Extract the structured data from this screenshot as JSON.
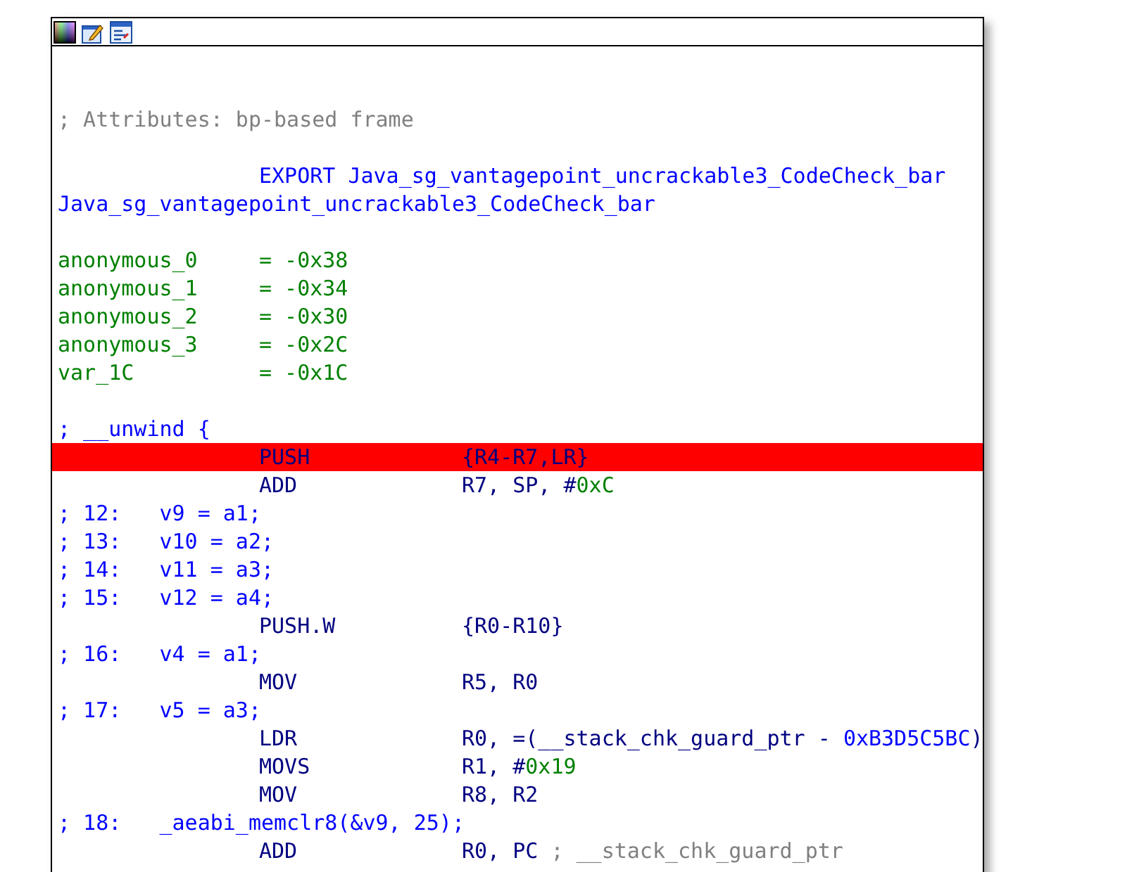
{
  "toolbar": {
    "buttons": [
      {
        "kind": "palette"
      },
      {
        "kind": "edit"
      },
      {
        "kind": "graph"
      }
    ]
  },
  "listing": [
    {
      "kind": "blank",
      "selected": false
    },
    {
      "kind": "blank",
      "selected": false
    },
    {
      "kind": "comment",
      "text": "; Attributes: bp-based frame",
      "selected": false
    },
    {
      "kind": "blank",
      "selected": false
    },
    {
      "kind": "export",
      "text": "EXPORT Java_sg_vantagepoint_uncrackable3_CodeCheck_bar",
      "selected": false
    },
    {
      "kind": "label",
      "text": "Java_sg_vantagepoint_uncrackable3_CodeCheck_bar",
      "selected": false
    },
    {
      "kind": "blank",
      "selected": false
    },
    {
      "kind": "stackvar",
      "name": "anonymous_0",
      "value": "= -0x38",
      "selected": false
    },
    {
      "kind": "stackvar",
      "name": "anonymous_1",
      "value": "= -0x34",
      "selected": false
    },
    {
      "kind": "stackvar",
      "name": "anonymous_2",
      "value": "= -0x30",
      "selected": false
    },
    {
      "kind": "stackvar",
      "name": "anonymous_3",
      "value": "= -0x2C",
      "selected": false
    },
    {
      "kind": "stackvar",
      "name": "var_1C",
      "value": "= -0x1C",
      "selected": false
    },
    {
      "kind": "blank",
      "selected": false
    },
    {
      "kind": "source",
      "text": "; __unwind {",
      "selected": false
    },
    {
      "kind": "instr",
      "mnemonic": "PUSH",
      "operands": [
        {
          "text": "{R4-R7,LR}",
          "kind": "plain"
        }
      ],
      "selected": true
    },
    {
      "kind": "instr",
      "mnemonic": "ADD",
      "operands": [
        {
          "text": "R7, SP, #",
          "kind": "plain"
        },
        {
          "text": "0xC",
          "kind": "number"
        }
      ],
      "selected": false
    },
    {
      "kind": "source",
      "text": "; 12:   v9 = a1;",
      "selected": false
    },
    {
      "kind": "source",
      "text": "; 13:   v10 = a2;",
      "selected": false
    },
    {
      "kind": "source",
      "text": "; 14:   v11 = a3;",
      "selected": false
    },
    {
      "kind": "source",
      "text": "; 15:   v12 = a4;",
      "selected": false
    },
    {
      "kind": "instr",
      "mnemonic": "PUSH.W",
      "operands": [
        {
          "text": "{R0-R10}",
          "kind": "plain"
        }
      ],
      "selected": false
    },
    {
      "kind": "source",
      "text": "; 16:   v4 = a1;",
      "selected": false
    },
    {
      "kind": "instr",
      "mnemonic": "MOV",
      "operands": [
        {
          "text": "R5, R0",
          "kind": "plain"
        }
      ],
      "selected": false
    },
    {
      "kind": "source",
      "text": "; 17:   v5 = a3;",
      "selected": false
    },
    {
      "kind": "instr",
      "mnemonic": "LDR",
      "operands": [
        {
          "text": "R0, =(__stack_chk_guard_ptr - ",
          "kind": "plain"
        },
        {
          "text": "0xB3D5C5BC",
          "kind": "name"
        },
        {
          "text": ")",
          "kind": "plain"
        }
      ],
      "selected": false
    },
    {
      "kind": "instr",
      "mnemonic": "MOVS",
      "operands": [
        {
          "text": "R1, #",
          "kind": "plain"
        },
        {
          "text": "0x19",
          "kind": "number"
        }
      ],
      "selected": false
    },
    {
      "kind": "instr",
      "mnemonic": "MOV",
      "operands": [
        {
          "text": "R8, R2",
          "kind": "plain"
        }
      ],
      "selected": false
    },
    {
      "kind": "source",
      "text": "; 18:   _aeabi_memclr8(&v9, 25);",
      "selected": false
    },
    {
      "kind": "instr",
      "mnemonic": "ADD",
      "operands": [
        {
          "text": "R0, PC ",
          "kind": "plain"
        },
        {
          "text": "; __stack_chk_guard_ptr",
          "kind": "comment"
        }
      ],
      "selected": false
    }
  ]
}
